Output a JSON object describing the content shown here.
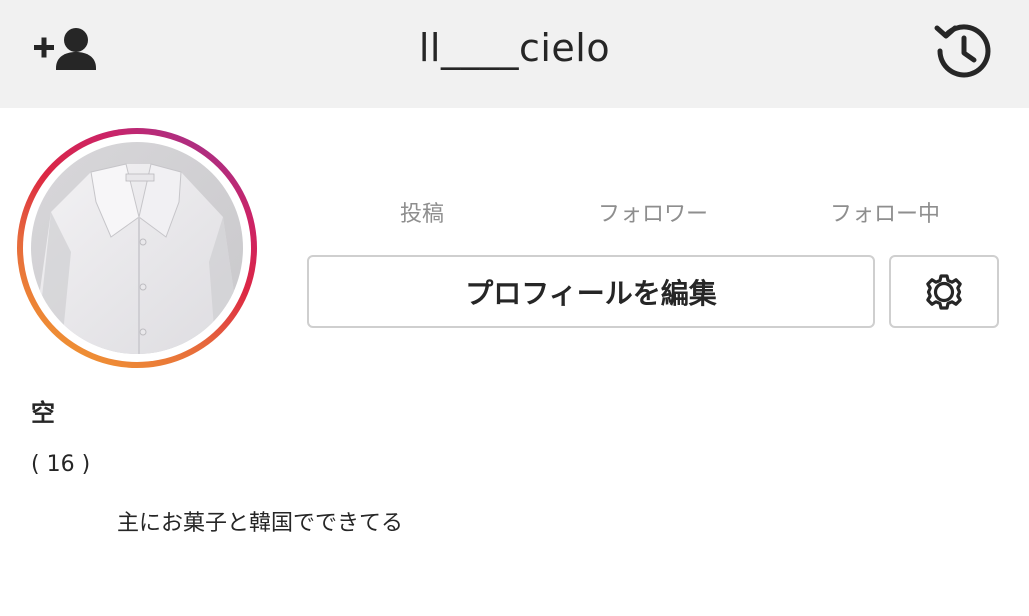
{
  "header": {
    "username": "ll____cielo",
    "add_person_icon": "add-person-icon",
    "history_icon": "history-icon"
  },
  "stats": {
    "posts_label": "投稿",
    "followers_label": "フォロワー",
    "following_label": "フォロー中"
  },
  "actions": {
    "edit_profile_label": "プロフィールを編集",
    "settings_icon": "gear-icon"
  },
  "bio": {
    "name": "空",
    "age": "( 16 )",
    "text": "主にお菓子と韓国でできてる"
  },
  "colors": {
    "topbar_bg": "#f1f1f1",
    "ring_start": "#f09433",
    "ring_end": "#8b3aa0",
    "button_border": "#cfcfcf",
    "muted_text": "#8e8e8e"
  }
}
